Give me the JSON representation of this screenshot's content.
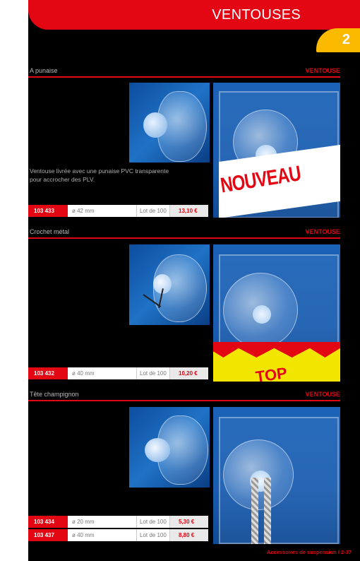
{
  "header": {
    "title": "VENTOUSES",
    "chapter": "2"
  },
  "sections": [
    {
      "name": "A punaise",
      "category": "VENTOUSE",
      "description_lines": [
        "Ventouse livrée avec une punaise PVC transparente",
        "pour accrocher des PLV."
      ],
      "scene_text": "NOUVEAU",
      "rows": [
        {
          "ref": "103 433",
          "dim": "ø 42 mm",
          "lot": "Lot de 100",
          "price": "13,10 €"
        }
      ]
    },
    {
      "name": "Crochet métal",
      "category": "VENTOUSE",
      "scene_text": "TOP",
      "rows": [
        {
          "ref": "103 432",
          "dim": "ø 40 mm",
          "lot": "Lot de 100",
          "price": "10,20 €"
        }
      ]
    },
    {
      "name": "Tête champignon",
      "category": "VENTOUSE",
      "rows": [
        {
          "ref": "103 434",
          "dim": "ø 20 mm",
          "lot": "Lot de 100",
          "price": "5,30 €"
        },
        {
          "ref": "103 437",
          "dim": "ø 40 mm",
          "lot": "Lot de 100",
          "price": "8,80 €"
        }
      ]
    }
  ],
  "footer": "Accessoires de suspension I 2-37",
  "colors": {
    "accent": "#e30613",
    "chapter": "#fbb900",
    "background": "#000000"
  }
}
